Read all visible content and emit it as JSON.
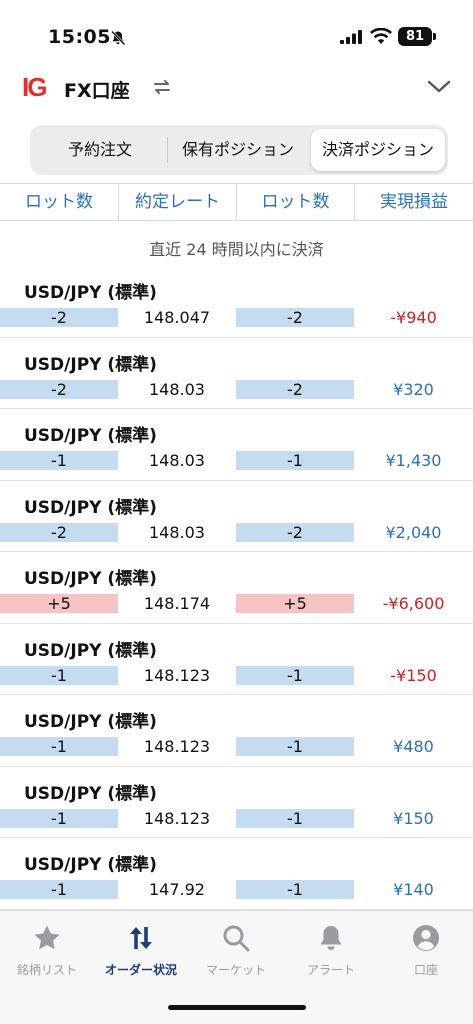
{
  "status_bar": {
    "time": "15:05",
    "battery": "81"
  },
  "header": {
    "logo": "IG",
    "title": "FX口座"
  },
  "segment": {
    "tabs": [
      "予約注文",
      "保有ポジション",
      "決済ポジション"
    ],
    "selected": 2
  },
  "columns": [
    "ロット数",
    "約定レート",
    "ロット数",
    "実現損益"
  ],
  "section_note": "直近 24 時間以内に決済",
  "rows": [
    {
      "pair": "USD/JPY (標準)",
      "open_lot": "-2",
      "rate": "148.047",
      "close_lot": "-2",
      "pnl": "-¥940",
      "side": "sell",
      "pnl_sign": "neg"
    },
    {
      "pair": "USD/JPY (標準)",
      "open_lot": "-2",
      "rate": "148.03",
      "close_lot": "-2",
      "pnl": "¥320",
      "side": "sell",
      "pnl_sign": "pos"
    },
    {
      "pair": "USD/JPY (標準)",
      "open_lot": "-1",
      "rate": "148.03",
      "close_lot": "-1",
      "pnl": "¥1,430",
      "side": "sell",
      "pnl_sign": "pos"
    },
    {
      "pair": "USD/JPY (標準)",
      "open_lot": "-2",
      "rate": "148.03",
      "close_lot": "-2",
      "pnl": "¥2,040",
      "side": "sell",
      "pnl_sign": "pos"
    },
    {
      "pair": "USD/JPY (標準)",
      "open_lot": "+5",
      "rate": "148.174",
      "close_lot": "+5",
      "pnl": "-¥6,600",
      "side": "buy",
      "pnl_sign": "neg"
    },
    {
      "pair": "USD/JPY (標準)",
      "open_lot": "-1",
      "rate": "148.123",
      "close_lot": "-1",
      "pnl": "-¥150",
      "side": "sell",
      "pnl_sign": "neg"
    },
    {
      "pair": "USD/JPY (標準)",
      "open_lot": "-1",
      "rate": "148.123",
      "close_lot": "-1",
      "pnl": "¥480",
      "side": "sell",
      "pnl_sign": "pos"
    },
    {
      "pair": "USD/JPY (標準)",
      "open_lot": "-1",
      "rate": "148.123",
      "close_lot": "-1",
      "pnl": "¥150",
      "side": "sell",
      "pnl_sign": "pos"
    },
    {
      "pair": "USD/JPY (標準)",
      "open_lot": "-1",
      "rate": "147.92",
      "close_lot": "-1",
      "pnl": "¥140",
      "side": "sell",
      "pnl_sign": "pos"
    }
  ],
  "tabbar": {
    "items": [
      {
        "label": "銘柄リスト",
        "icon": "star-icon"
      },
      {
        "label": "オーダー状況",
        "icon": "up-down-arrows-icon"
      },
      {
        "label": "マーケット",
        "icon": "search-icon"
      },
      {
        "label": "アラート",
        "icon": "bell-icon"
      },
      {
        "label": "口座",
        "icon": "account-icon"
      }
    ],
    "active": 1
  },
  "colors": {
    "accent_blue": "#2b72b8",
    "negative_red": "#c0282b",
    "sell_fill": "#c5dbef",
    "buy_fill": "#f6c4c4",
    "logo_red": "#e0302b",
    "active_tab": "#1f3f73"
  }
}
